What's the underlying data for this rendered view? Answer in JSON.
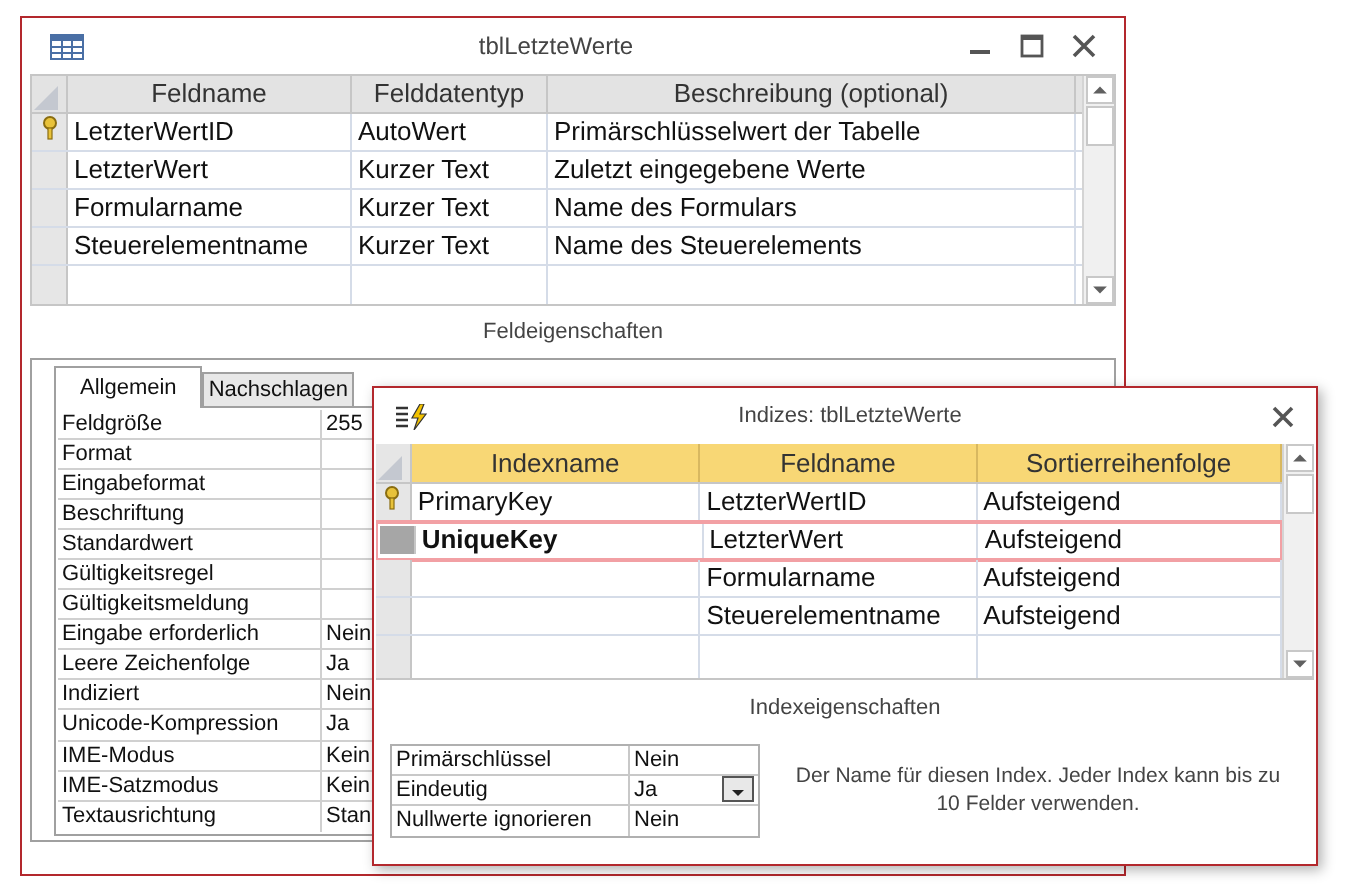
{
  "main_window": {
    "title": "tblLetzteWerte",
    "columns": [
      "Feldname",
      "Felddatentyp",
      "Beschreibung (optional)"
    ],
    "rows": [
      {
        "primary_key": true,
        "cells": [
          "LetzterWertID",
          "AutoWert",
          "Primärschlüsselwert der Tabelle"
        ]
      },
      {
        "primary_key": false,
        "cells": [
          "LetzterWert",
          "Kurzer Text",
          "Zuletzt eingegebene Werte"
        ]
      },
      {
        "primary_key": false,
        "cells": [
          "Formularname",
          "Kurzer Text",
          "Name des Formulars"
        ]
      },
      {
        "primary_key": false,
        "cells": [
          "Steuerelementname",
          "Kurzer Text",
          "Name des Steuerelements"
        ]
      }
    ],
    "section_title": "Feldeigenschaften",
    "tabs": [
      {
        "label": "Allgemein",
        "selected": true
      },
      {
        "label": "Nachschlagen",
        "selected": false
      }
    ],
    "properties": [
      {
        "label": "Feldgröße",
        "value": "255"
      },
      {
        "label": "Format"
      },
      {
        "label": "Eingabeformat"
      },
      {
        "label": "Beschriftung"
      },
      {
        "label": "Standardwert"
      },
      {
        "label": "Gültigkeitsregel"
      },
      {
        "label": "Gültigkeitsmeldung"
      },
      {
        "label": "Eingabe erforderlich",
        "value": "Nein"
      },
      {
        "label": "Leere Zeichenfolge",
        "value": "Ja"
      },
      {
        "label": "Indiziert",
        "value": "Nein"
      },
      {
        "label": "Unicode-Kompression",
        "value": "Ja"
      },
      {
        "label": "IME-Modus",
        "value": "Kein"
      },
      {
        "label": "IME-Satzmodus",
        "value": "Kein"
      },
      {
        "label": "Textausrichtung",
        "value": "Stan"
      }
    ]
  },
  "index_dialog": {
    "title": "Indizes: tblLetzteWerte",
    "columns": [
      "Indexname",
      "Feldname",
      "Sortierreihenfolge"
    ],
    "rows": [
      {
        "primary_key": true,
        "selected": false,
        "index_name": "PrimaryKey",
        "field": "LetzterWertID",
        "order": "Aufsteigend"
      },
      {
        "primary_key": false,
        "selected": true,
        "index_name": "UniqueKey",
        "field": "LetzterWert",
        "order": "Aufsteigend"
      },
      {
        "primary_key": false,
        "selected": false,
        "field": "Formularname",
        "order": "Aufsteigend"
      },
      {
        "primary_key": false,
        "selected": false,
        "field": "Steuerelementname",
        "order": "Aufsteigend"
      }
    ],
    "section_title": "Indexeigenschaften",
    "properties": [
      {
        "label": "Primärschlüssel",
        "value": "Nein",
        "dropdown": false
      },
      {
        "label": "Eindeutig",
        "value": "Ja",
        "dropdown": true
      },
      {
        "label": "Nullwerte ignorieren",
        "value": "Nein",
        "dropdown": false
      }
    ],
    "help_text": "Der Name für diesen Index. Jeder Index kann bis zu 10 Felder verwenden."
  }
}
